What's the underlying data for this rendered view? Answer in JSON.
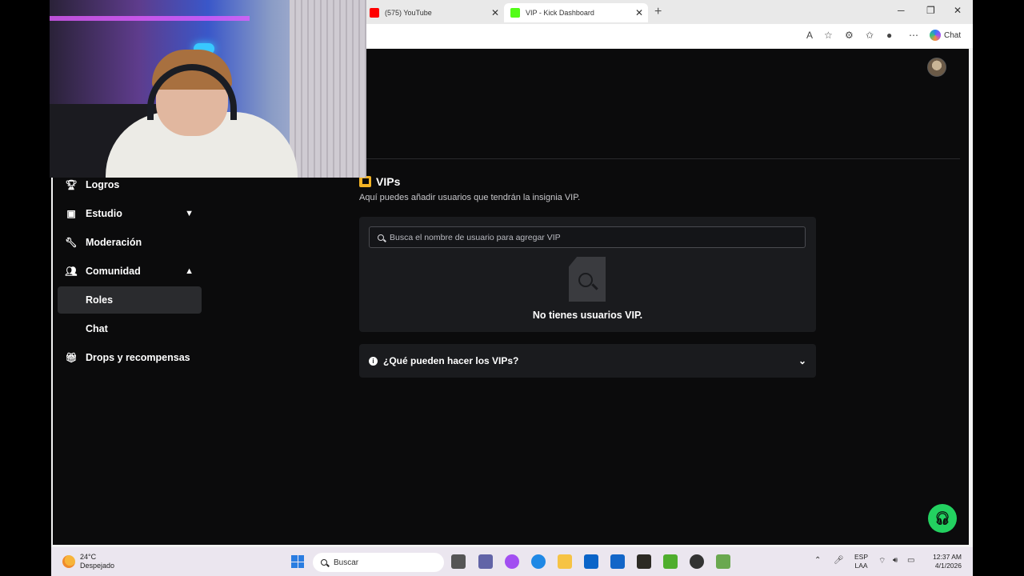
{
  "browser": {
    "tabs": [
      {
        "label": "(575) YouTube",
        "active": false,
        "favicon_color": "#ff0000"
      },
      {
        "label": "VIP - Kick Dashboard",
        "active": true,
        "favicon_color": "#53fc18"
      }
    ],
    "chat_label": "Chat"
  },
  "sidebar": {
    "items": [
      {
        "label": "Logros",
        "icon": "trophy-icon"
      },
      {
        "label": "Estudio",
        "icon": "studio-icon",
        "expanded": false
      },
      {
        "label": "Moderación",
        "icon": "wrench-icon"
      },
      {
        "label": "Comunidad",
        "icon": "community-icon",
        "expanded": true
      },
      {
        "label": "Roles",
        "icon": "",
        "selected": true
      },
      {
        "label": "Chat",
        "icon": ""
      },
      {
        "label": "Drops y recompensas",
        "icon": "gift-icon"
      }
    ]
  },
  "main": {
    "title": "VIPs",
    "subtitle": "Aquí puedes añadir usuarios que tendrán la insignia VIP.",
    "search_placeholder": "Busca el nombre de usuario para agregar VIP",
    "empty_text": "No tienes usuarios VIP.",
    "faq_label": "¿Qué pueden hacer los VIPs?"
  },
  "colors": {
    "accent_green": "#53fc18",
    "vip_badge": "#f3b324",
    "background": "#0b0b0c",
    "card": "#1a1b1e"
  },
  "taskbar": {
    "weather_temp": "24°C",
    "weather_desc": "Despejado",
    "search_label": "Buscar",
    "lang_line1": "ESP",
    "lang_line2": "LAA",
    "time": "12:37 AM",
    "date": "4/1/2026"
  }
}
